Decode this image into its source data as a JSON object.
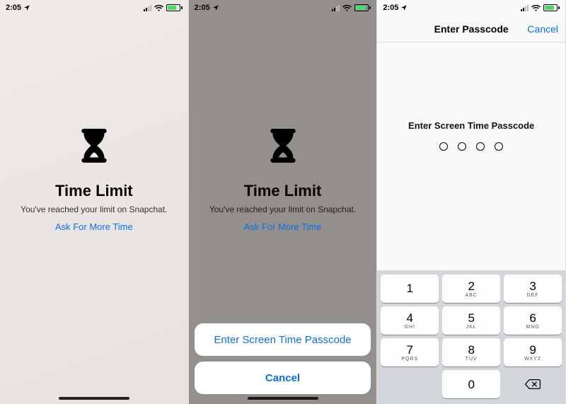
{
  "status": {
    "time": "2:05",
    "location_icon": "location-arrow",
    "signal_icon": "cellular-signal",
    "wifi_icon": "wifi",
    "battery_icon": "battery-charging"
  },
  "screen1": {
    "title": "Time Limit",
    "subtitle": "You've reached your limit on Snapchat.",
    "ask_link": "Ask For More Time"
  },
  "screen2": {
    "title": "Time Limit",
    "subtitle": "You've reached your limit on Snapchat.",
    "ask_link": "Ask For More Time",
    "sheet_primary": "Enter Screen Time Passcode",
    "sheet_cancel": "Cancel"
  },
  "screen3": {
    "nav_title": "Enter Passcode",
    "nav_cancel": "Cancel",
    "prompt": "Enter Screen Time Passcode",
    "keypad": {
      "keys": [
        {
          "num": "1",
          "letters": ""
        },
        {
          "num": "2",
          "letters": "ABC"
        },
        {
          "num": "3",
          "letters": "DEF"
        },
        {
          "num": "4",
          "letters": "GHI"
        },
        {
          "num": "5",
          "letters": "JKL"
        },
        {
          "num": "6",
          "letters": "MNO"
        },
        {
          "num": "7",
          "letters": "PQRS"
        },
        {
          "num": "8",
          "letters": "TUV"
        },
        {
          "num": "9",
          "letters": "WXYZ"
        },
        {
          "num": "0",
          "letters": ""
        }
      ],
      "backspace_icon": "delete-left"
    }
  }
}
